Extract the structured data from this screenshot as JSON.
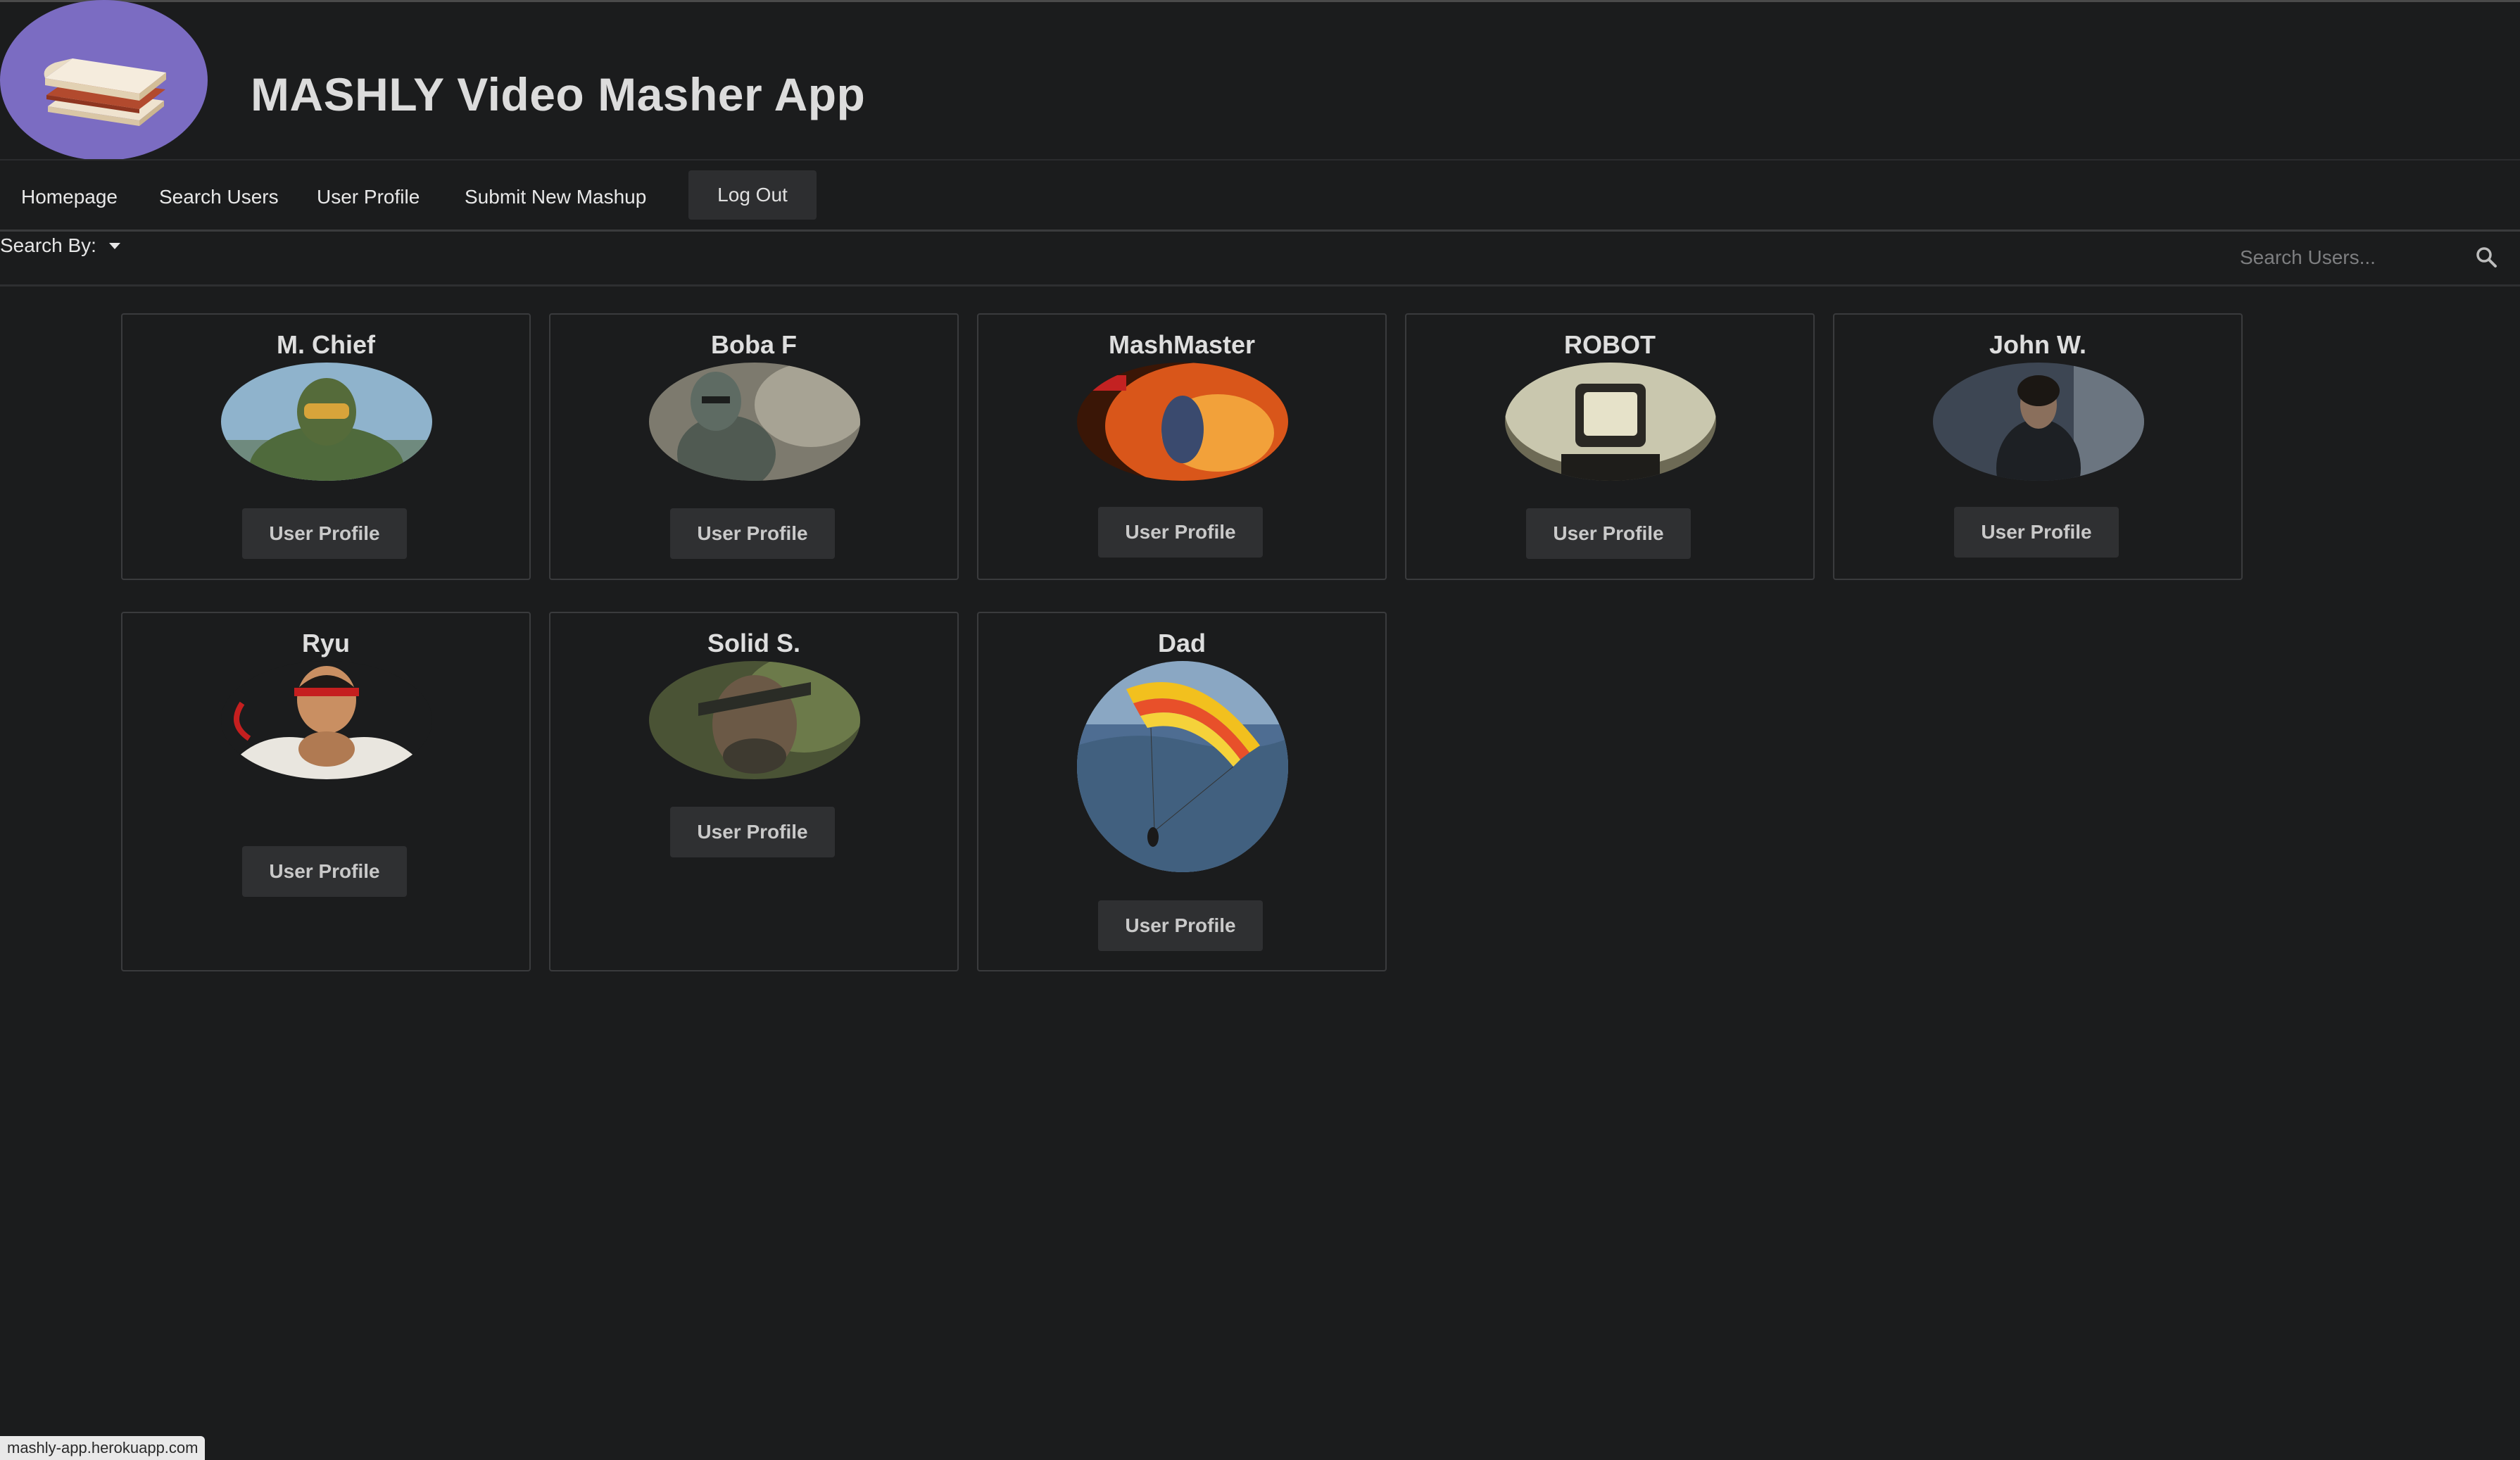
{
  "app": {
    "title": "MASHLY Video Masher App"
  },
  "nav": {
    "items": [
      "Homepage",
      "Search Users",
      "User Profile",
      "Submit New Mashup"
    ],
    "logout_label": "Log Out"
  },
  "search": {
    "by_label": "Search By:",
    "placeholder": "Search Users..."
  },
  "users": [
    {
      "name": "M. Chief",
      "button": "User Profile"
    },
    {
      "name": "Boba F",
      "button": "User Profile"
    },
    {
      "name": "MashMaster",
      "button": "User Profile"
    },
    {
      "name": "ROBOT",
      "button": "User Profile"
    },
    {
      "name": "John W.",
      "button": "User Profile"
    },
    {
      "name": "Ryu",
      "button": "User Profile"
    },
    {
      "name": "Solid S.",
      "button": "User Profile"
    },
    {
      "name": "Dad",
      "button": "User Profile"
    }
  ],
  "status": {
    "url": "mashly-app.herokuapp.com"
  },
  "colors": {
    "background": "#1b1c1d",
    "logo_bg": "#7b6cc2",
    "button_bg": "#2f3032",
    "card_border": "#3a3b3d"
  },
  "icons": [
    "sandwich-logo-icon",
    "dropdown-caret-icon",
    "search-icon"
  ]
}
